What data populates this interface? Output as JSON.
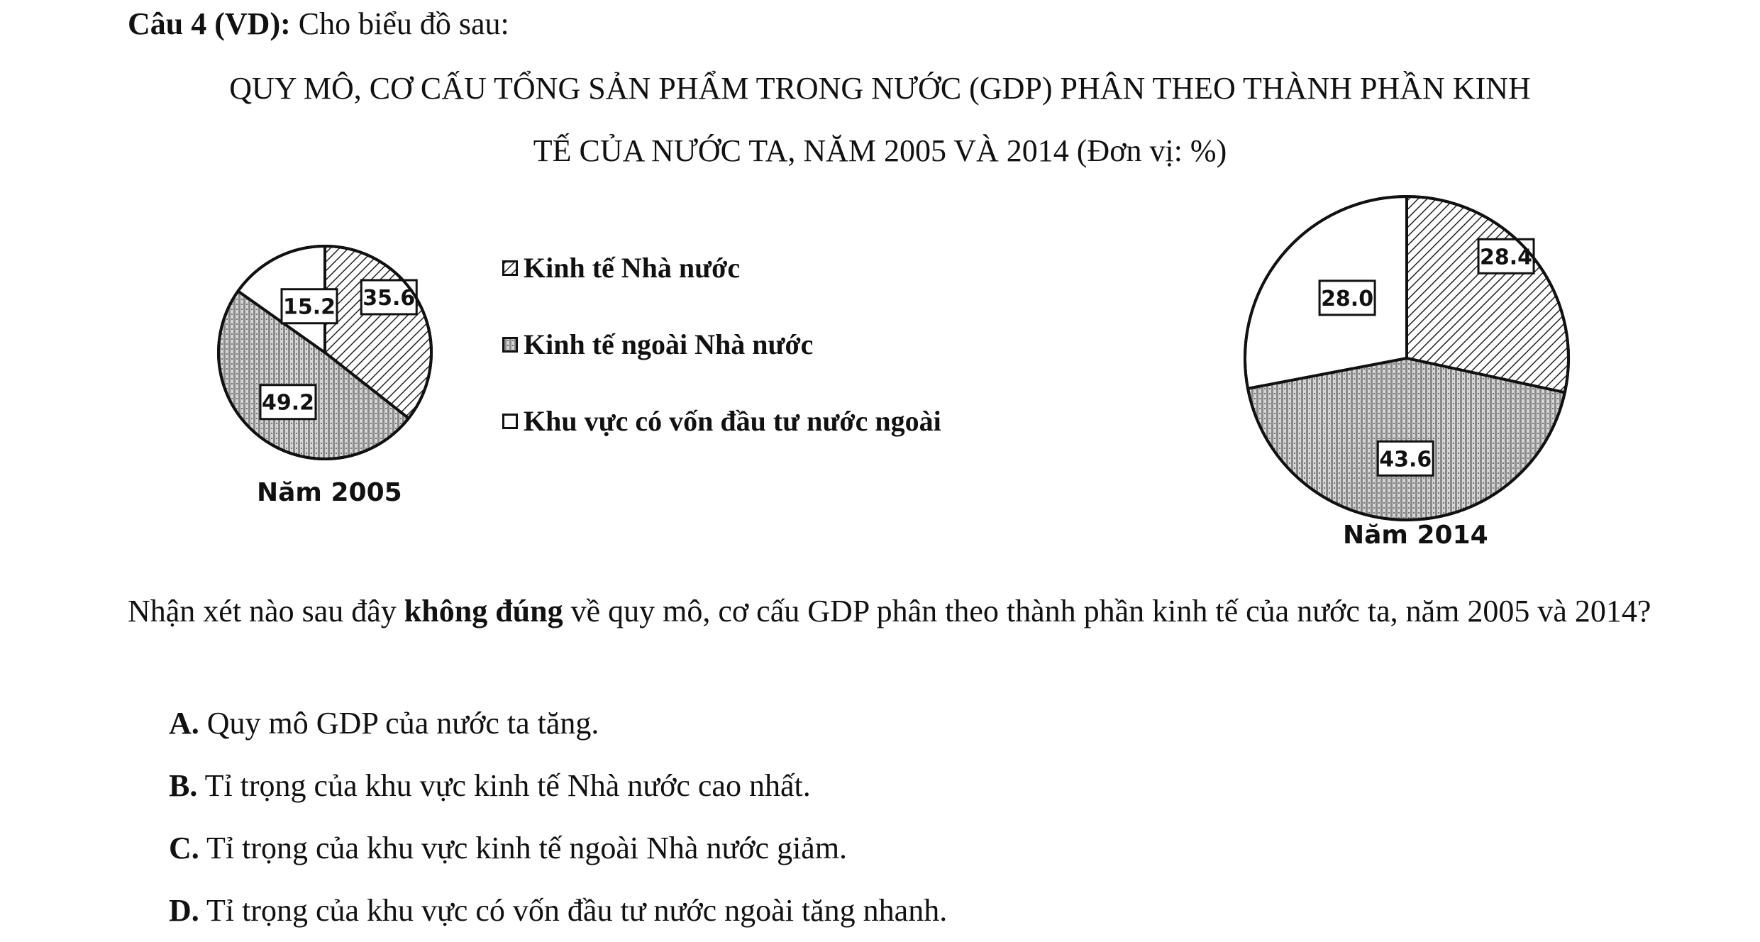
{
  "question": {
    "label": "Câu 4 (VD):",
    "intro": " Cho biểu đồ sau:",
    "title_line1": "QUY MÔ, CƠ CẤU TỔNG SẢN PHẨM TRONG NƯỚC (GDP) PHÂN THEO THÀNH PHẦN KINH",
    "title_line2": "TẾ CỦA NƯỚC TA, NĂM 2005 VÀ 2014 (Đơn vị: %)",
    "stem_pre": "Nhận xét nào sau đây ",
    "stem_bold": "không đúng",
    "stem_post": " về quy mô, cơ cấu GDP phân theo thành phần kinh tế của nước ta, năm 2005 và 2014?",
    "options": [
      {
        "letter": "A.",
        "text": " Quy mô GDP của nước ta tăng."
      },
      {
        "letter": "B.",
        "text": " Tỉ trọng của khu vực kinh tế Nhà nước cao nhất."
      },
      {
        "letter": "C.",
        "text": " Tỉ trọng của khu vực kinh tế ngoài Nhà nước giảm."
      },
      {
        "letter": "D.",
        "text": " Tỉ trọng của khu vực có vốn đầu tư nước ngoài tăng nhanh."
      }
    ]
  },
  "legend": [
    {
      "label": "Kinh tế Nhà nước",
      "pattern": "diag"
    },
    {
      "label": "Kinh tế ngoài Nhà nước",
      "pattern": "dots"
    },
    {
      "label": "Khu vực có vốn đầu tư nước ngoài",
      "pattern": "blank"
    }
  ],
  "chart_data": [
    {
      "type": "pie",
      "caption": "Năm 2005",
      "unit": "%",
      "slices": [
        {
          "name": "Kinh tế Nhà nước",
          "value": 35.6,
          "label": "35.6"
        },
        {
          "name": "Kinh tế ngoài Nhà nước",
          "value": 49.2,
          "label": "49.2"
        },
        {
          "name": "Khu vực có vốn đầu tư nước ngoài",
          "value": 15.2,
          "label": "15.2"
        }
      ]
    },
    {
      "type": "pie",
      "caption": "Năm 2014",
      "unit": "%",
      "slices": [
        {
          "name": "Kinh tế Nhà nước",
          "value": 28.4,
          "label": "28.4"
        },
        {
          "name": "Kinh tế ngoài Nhà nước",
          "value": 43.6,
          "label": "43.6"
        },
        {
          "name": "Khu vực có vốn đầu tư nước ngoài",
          "value": 28.0,
          "label": "28.0"
        }
      ]
    }
  ],
  "colors": {
    "stroke": "#111111",
    "background": "#ffffff"
  }
}
